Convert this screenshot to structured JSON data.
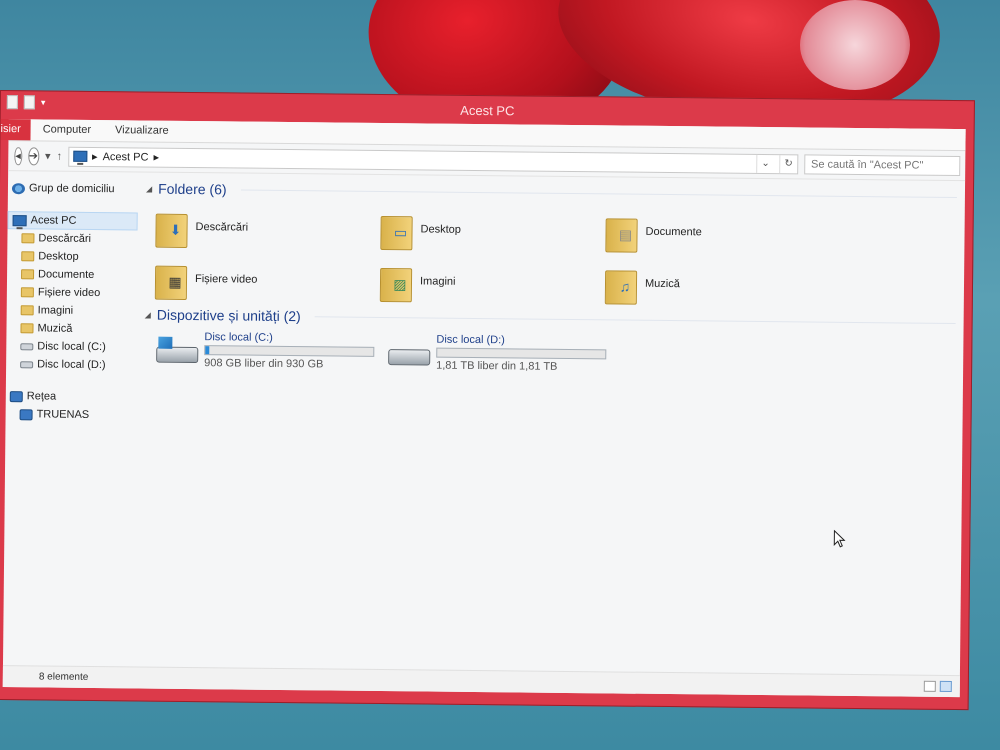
{
  "window": {
    "title": "Acest PC"
  },
  "ribbon": {
    "tabs": [
      "isier",
      "Computer",
      "Vizualizare"
    ]
  },
  "address": {
    "path": "Acest PC",
    "separator": "▸"
  },
  "search": {
    "placeholder": "Se caută în \"Acest PC\""
  },
  "nav": {
    "homegroup": "Grup de domiciliu",
    "this_pc": "Acest PC",
    "items": [
      "Descărcări",
      "Desktop",
      "Documente",
      "Fișiere video",
      "Imagini",
      "Muzică",
      "Disc local (C:)",
      "Disc local (D:)"
    ],
    "network": "Rețea",
    "network_items": [
      "TRUENAS"
    ]
  },
  "folders": {
    "header": "Foldere (6)",
    "items": [
      {
        "name": "Descărcări",
        "icon": "download-icon"
      },
      {
        "name": "Desktop",
        "icon": "desktop-icon"
      },
      {
        "name": "Documente",
        "icon": "document-icon"
      },
      {
        "name": "Fișiere video",
        "icon": "video-icon"
      },
      {
        "name": "Imagini",
        "icon": "image-icon"
      },
      {
        "name": "Muzică",
        "icon": "music-icon"
      }
    ]
  },
  "devices": {
    "header": "Dispozitive și unități (2)",
    "items": [
      {
        "name": "Disc local (C:)",
        "free": "908 GB liber din 930 GB",
        "used_fraction": 0.024
      },
      {
        "name": "Disc local (D:)",
        "free": "1,81 TB liber din 1,81 TB",
        "used_fraction": 0.0
      }
    ]
  },
  "status": {
    "count": "8 elemente"
  },
  "colors": {
    "accent": "#dc3a4a",
    "selection": "#dbe9f7",
    "drive_bar": "#2a8ad8"
  }
}
